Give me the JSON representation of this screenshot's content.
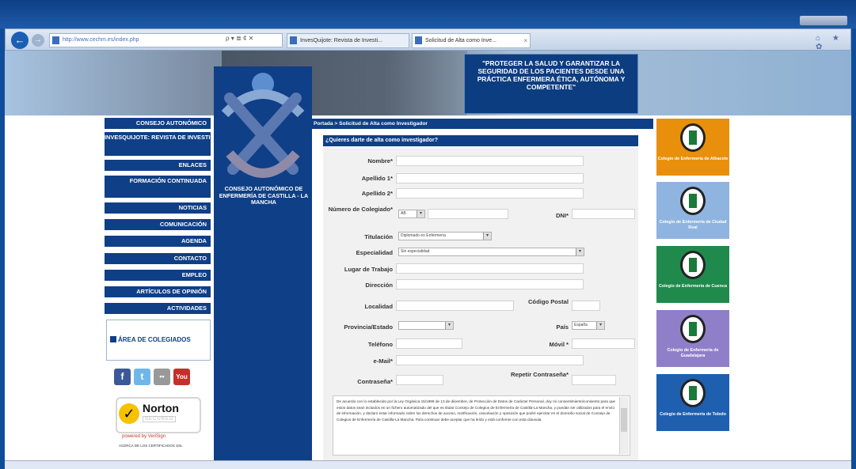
{
  "browser": {
    "address_url": "http://www.cechm.es/index.php",
    "address_tools": "ρ ▾ ≣ ¢ ✕",
    "tabs": [
      {
        "label": "InvesQuijote: Revista de Investi..."
      },
      {
        "label": "Solicitud de Alta como Inve...",
        "close": "×"
      }
    ],
    "home_icons": "⌂ ★ ✿",
    "back_glyph": "←",
    "fwd_glyph": "→"
  },
  "banner": {
    "quote": "\"PROTEGER LA SALUD Y GARANTIZAR LA SEGURIDAD DE LOS PACIENTES DESDE UNA PRÁCTICA ENFERMERA ÉTICA, AUTÓNOMA Y COMPETENTE\""
  },
  "sidebar": {
    "items": [
      {
        "label": "CONSEJO AUTONÓMICO"
      },
      {
        "label": "INVESQUIJOTE: REVISTA DE INVESTIGACIÓN"
      },
      {
        "label": "ENLACES"
      },
      {
        "label": "FORMACIÓN CONTINUADA"
      },
      {
        "label": "NOTICIAS"
      },
      {
        "label": "COMUNICACIÓN"
      },
      {
        "label": "AGENDA"
      },
      {
        "label": "CONTACTO"
      },
      {
        "label": "EMPLEO"
      },
      {
        "label": "ARTÍCULOS DE OPINIÓN"
      },
      {
        "label": "ACTIVIDADES"
      }
    ],
    "colegiados": "ÁREA DE COLEGIADOS",
    "social": [
      "f",
      "t",
      "••",
      "You"
    ],
    "norton": {
      "brand": "Norton",
      "secured": "SECURED",
      "powered": "powered by VeriSign",
      "about": "ACERCA DE LOS CERTIFICADOS SSL"
    }
  },
  "logo": {
    "text": "CONSEJO AUTONÓMICO DE ENFERMERÍA DE CASTILLA - LA MANCHA"
  },
  "breadcrumb": "Portada > Solicitud de Alta como Investigador",
  "form": {
    "title": "¿Quieres darte de alta como investigador?",
    "labels": {
      "nombre": "Nombre*",
      "apellido1": "Apellido 1*",
      "apellido2": "Apellido 2*",
      "numero": "Número de Colegiado*",
      "dni": "DNI*",
      "titulacion": "Titulación",
      "especialidad": "Especialidad",
      "lugar": "Lugar de Trabajo",
      "direccion": "Dirección",
      "localidad": "Localidad",
      "codigo": "Código Postal",
      "provincia": "Provincia/Estado",
      "pais": "País",
      "telefono": "Teléfono",
      "movil": "Móvil *",
      "email": "e-Mail*",
      "contrasena": "Contraseña*",
      "repetir": "Repetir Contraseña*"
    },
    "values": {
      "numero_prefix": "AB",
      "titulacion": "Diplomado en Enfermería",
      "especialidad": "Sin especialidad",
      "provincia": "",
      "pais": "España"
    },
    "legal": "De acuerdo con lo establecido por la Ley Orgánica 15/1999 de 13 de diciembre, de Protección de Datos de Carácter Personal, doy mi consentimiento/consiento para que estos datos sean incluidos en un fichero automatizado del que es titular Consejo de Colegios de Enfermería de Castilla-La Mancha, y puedan ser utilizados para el envío de información, y declaro estar informado sobre los derechos de acceso, rectificación, cancelación y oposición que podré ejercitar en el domicilio social de Consejo de Colegios de Enfermería de Castilla-La Mancha. Para continuar debe aceptar que ha leído y está conforme con esta cláusula."
  },
  "colleges": [
    {
      "name": "Colegio de Enfermería de Albacete",
      "color": "#e8900c"
    },
    {
      "name": "Colegio de Enfermería de Ciudad Real",
      "color": "#8fb4df"
    },
    {
      "name": "Colegio de Enfermería de Cuenca",
      "color": "#1f8a4c"
    },
    {
      "name": "Colegio de Enfermería de Guadalajara",
      "color": "#8f7fc9"
    },
    {
      "name": "Colegio de Enfermería de Toledo",
      "color": "#1e5fb0"
    }
  ],
  "colors": {
    "navy": "#0f3f86",
    "accent": "#1a5fb4"
  }
}
